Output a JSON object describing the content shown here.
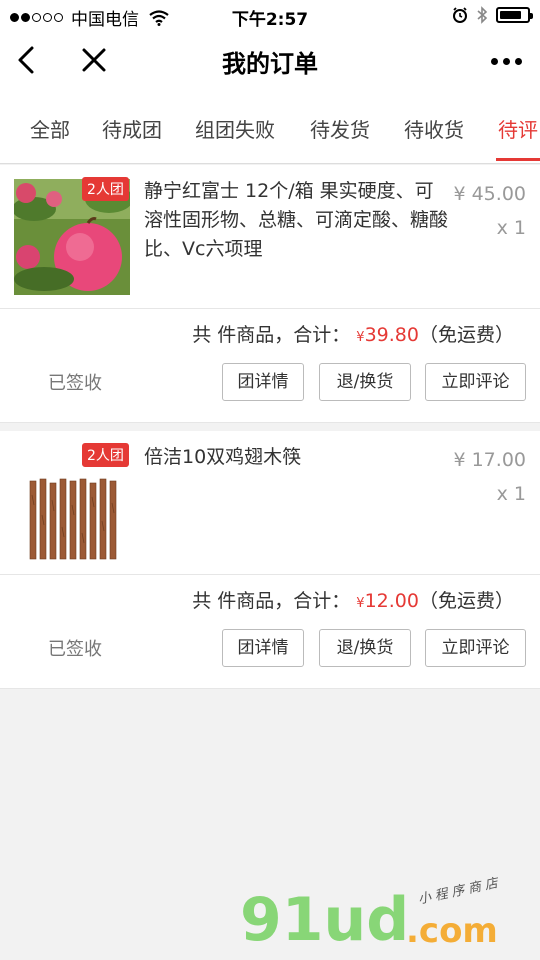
{
  "status_bar": {
    "carrier": "中国电信",
    "time": "下午2:57"
  },
  "nav": {
    "title": "我的订单"
  },
  "tabs": [
    {
      "label": "全部",
      "active": false
    },
    {
      "label": "待成团",
      "active": false
    },
    {
      "label": "组团失败",
      "active": false
    },
    {
      "label": "待发货",
      "active": false
    },
    {
      "label": "待收货",
      "active": false
    },
    {
      "label": "待评",
      "active": true
    }
  ],
  "orders": [
    {
      "badge": "2人团",
      "name": "静宁红富士 12个/箱 果实硬度、可溶性固形物、总糖、可滴定酸、糖酸比、Vc六项理",
      "price": "¥ 45.00",
      "qty": "x 1",
      "summary_prefix": "共 件商品，合计：",
      "currency": "¥",
      "total": "39.80",
      "shipping": "（免运费）",
      "status": "已签收",
      "buttons": [
        "团详情",
        "退/换货",
        "立即评论"
      ]
    },
    {
      "badge": "2人团",
      "name": "倍洁10双鸡翅木筷",
      "price": "¥ 17.00",
      "qty": "x 1",
      "summary_prefix": "共 件商品，合计：",
      "currency": "¥",
      "total": "12.00",
      "shipping": "（免运费）",
      "status": "已签收",
      "buttons": [
        "团详情",
        "退/换货",
        "立即评论"
      ]
    }
  ],
  "watermark": {
    "main": "91ud",
    "domain": ".com",
    "tagline": "小程序商店"
  },
  "colors": {
    "accent": "#e53935",
    "watermark_green": "#7dd36a"
  }
}
